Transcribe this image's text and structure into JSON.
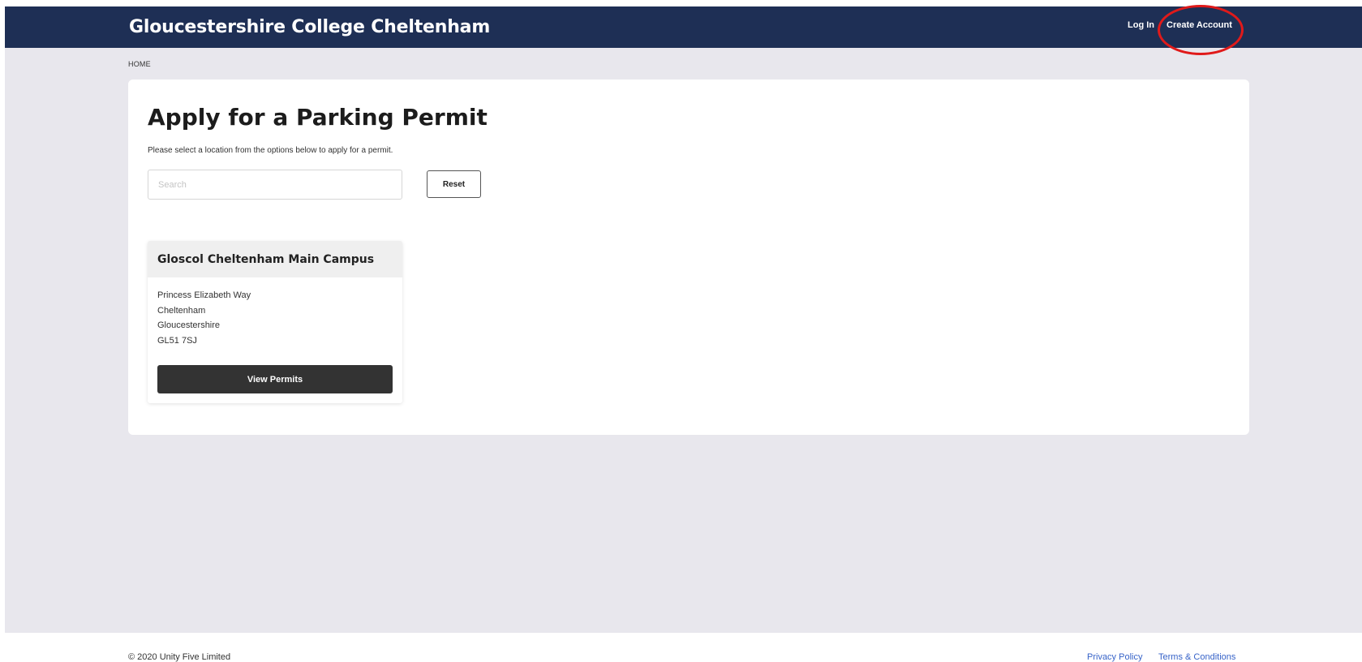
{
  "header": {
    "title": "Gloucestershire College Cheltenham",
    "login_label": "Log In",
    "create_account_label": "Create Account",
    "annotation_color": "#e01a1a",
    "background_color": "#1e2f55"
  },
  "breadcrumb": {
    "home": "HOME"
  },
  "main": {
    "title": "Apply for a Parking Permit",
    "intro": "Please select a location from the options below to apply for a permit.",
    "search": {
      "placeholder": "Search",
      "value": ""
    },
    "reset_label": "Reset",
    "locations": [
      {
        "name": "Gloscol Cheltenham Main Campus",
        "address": [
          "Princess Elizabeth Way",
          "Cheltenham",
          "Gloucestershire",
          "GL51 7SJ"
        ],
        "button_label": "View Permits"
      }
    ]
  },
  "footer": {
    "copyright": "© 2020 Unity Five Limited",
    "links": [
      "Privacy Policy",
      "Terms & Conditions"
    ],
    "link_color": "#3763c8"
  }
}
